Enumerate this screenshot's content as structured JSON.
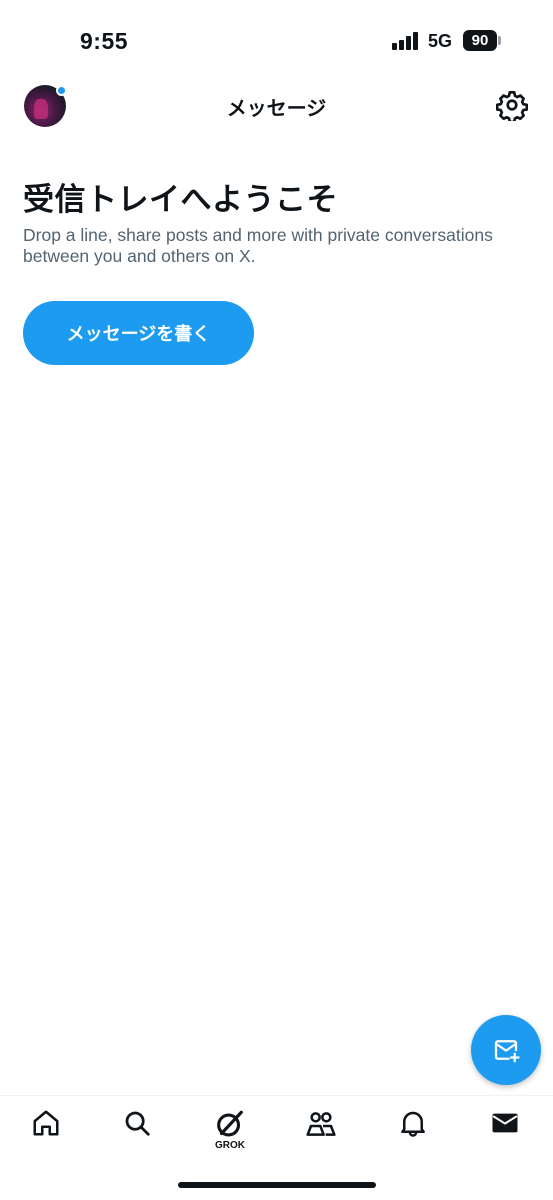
{
  "status_bar": {
    "time": "9:55",
    "network": "5G",
    "battery": "90"
  },
  "header": {
    "title": "メッセージ",
    "avatar_icon": "avatar",
    "settings_icon": "gear-icon"
  },
  "welcome": {
    "title": "受信トレイへようこそ",
    "description": "Drop a line, share posts and more with private conversations between you and others on X.",
    "write_button": "メッセージを書く"
  },
  "fab": {
    "icon": "new-message-icon"
  },
  "bottom_nav": {
    "items": [
      {
        "name": "home",
        "icon": "home-icon"
      },
      {
        "name": "search",
        "icon": "search-icon"
      },
      {
        "name": "grok",
        "icon": "grok-icon",
        "label": "GROK"
      },
      {
        "name": "communities",
        "icon": "people-icon"
      },
      {
        "name": "notifications",
        "icon": "bell-icon"
      },
      {
        "name": "messages",
        "icon": "envelope-icon"
      }
    ]
  },
  "colors": {
    "accent": "#1d9bf0",
    "text_primary": "#0f1419",
    "text_secondary": "#536471"
  }
}
